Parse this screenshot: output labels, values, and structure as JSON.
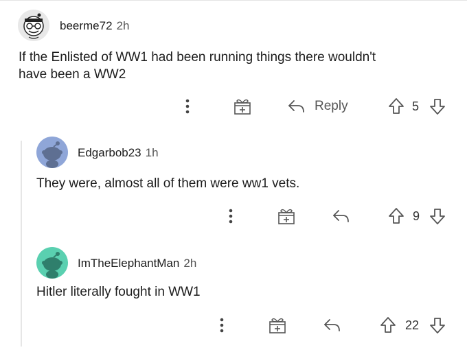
{
  "comments": [
    {
      "username": "beerme72",
      "time": "2h",
      "body_lines": [
        "If the Enlisted of WW1 had been running things there wouldn't",
        "have been a WW2"
      ],
      "reply_label": "Reply",
      "score": "5"
    },
    {
      "username": "Edgarbob23",
      "time": "1h",
      "body": "They were, almost all of them were ww1 vets.",
      "score": "9"
    },
    {
      "username": "ImTheElephantMan",
      "time": "2h",
      "body": "Hitler literally fought in WW1",
      "score": "22"
    }
  ],
  "icons": {
    "more": "more-options-icon",
    "award": "award-icon",
    "reply": "reply-arrow-icon",
    "upvote": "upvote-icon",
    "downvote": "downvote-icon"
  },
  "colors": {
    "text": "#1c1c1c",
    "muted": "#555555",
    "avatar1_bg": "#e8e8e8",
    "avatar2_bg": "#8fa6d8",
    "avatar3_bg": "#5ad0b0"
  }
}
